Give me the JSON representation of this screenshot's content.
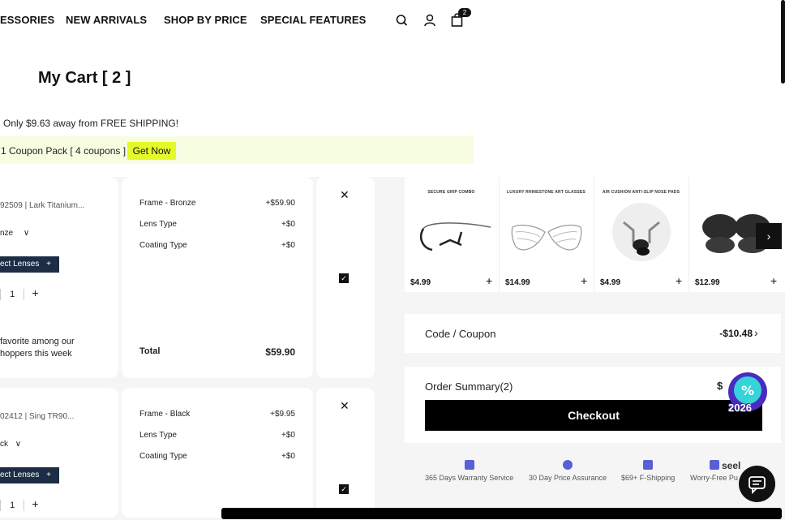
{
  "nav": {
    "items": [
      "ESSORIES",
      "NEW ARRIVALS",
      "SHOP BY PRICE",
      "SPECIAL FEATURES"
    ],
    "cart_count": "2"
  },
  "cart": {
    "title": "My Cart [ 2 ]",
    "shipping_msg": "Only $9.63 away from FREE SHIPPING!",
    "coupon_msg": "1 Coupon Pack [ 4 coupons ]",
    "get_now": "Get Now",
    "items": [
      {
        "name": "92509 | Lark Titanium...",
        "color": "nze",
        "select_lenses": "ect Lenses",
        "qty": "1",
        "note": "favorite among our\nhoppers this week",
        "frame_label": "Frame - Bronze",
        "frame_price": "+$59.90",
        "lens_label": "Lens Type",
        "lens_price": "+$0",
        "coating_label": "Coating Type",
        "coating_price": "+$0",
        "total_label": "Total",
        "total": "$59.90"
      },
      {
        "name": "02412 | Sing TR90...",
        "color": "ck",
        "select_lenses": "ect Lenses",
        "qty": "1",
        "frame_label": "Frame - Black",
        "frame_price": "+$9.95",
        "lens_label": "Lens Type",
        "lens_price": "+$0",
        "coating_label": "Coating Type",
        "coating_price": "+$0"
      }
    ]
  },
  "recommendations": [
    {
      "title": "SECURE GRIP COMBO",
      "price": "$4.99"
    },
    {
      "title": "LUXURY RHINESTONE ART GLASSES",
      "price": "$14.99"
    },
    {
      "title": "AIR CUSHION ANTI-SLIP NOSE PADS",
      "price": "$4.99"
    },
    {
      "title": "",
      "price": "$12.99"
    }
  ],
  "coupon": {
    "label": "Code / Coupon",
    "value": "-$10.48"
  },
  "summary": {
    "label": "Order Summary(2)",
    "value": "$",
    "checkout": "Checkout"
  },
  "assurances": [
    "365 Days Warranty Service",
    "30 Day Price Assurance",
    "$69+ F-Shipping",
    "Worry-Free Pu"
  ],
  "seel": "seel",
  "promo_badge": "2026",
  "colors": {
    "accent": "#e3f92a",
    "dark": "#1c2d45",
    "coupon_bg": "#f6fde0"
  }
}
